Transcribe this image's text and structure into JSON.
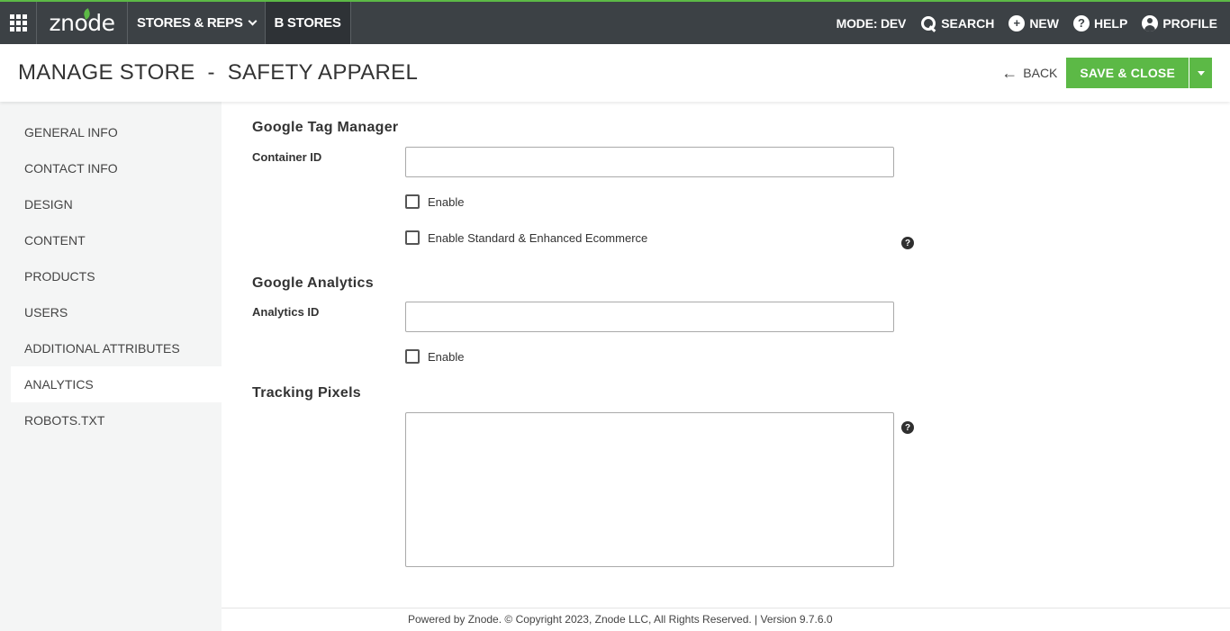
{
  "topbar": {
    "brand": "znode",
    "nav": [
      {
        "label": "STORES & REPS",
        "dropdown": true
      },
      {
        "label": "B STORES"
      }
    ],
    "mode": "MODE: DEV",
    "search": "SEARCH",
    "new": "NEW",
    "help": "HELP",
    "profile": "PROFILE",
    "accent_color": "#5cb946"
  },
  "header": {
    "title": "MANAGE STORE  -  SAFETY APPAREL",
    "back": "BACK",
    "save_close": "SAVE & CLOSE"
  },
  "sidebar": {
    "items": [
      {
        "label": "GENERAL INFO"
      },
      {
        "label": "CONTACT INFO"
      },
      {
        "label": "DESIGN"
      },
      {
        "label": "CONTENT"
      },
      {
        "label": "PRODUCTS"
      },
      {
        "label": "USERS"
      },
      {
        "label": "ADDITIONAL ATTRIBUTES"
      },
      {
        "label": "ANALYTICS",
        "active": true
      },
      {
        "label": "ROBOTS.TXT"
      }
    ]
  },
  "main": {
    "gtm": {
      "title": "Google Tag Manager",
      "container_label": "Container ID",
      "container_value": "",
      "enable_label": "Enable",
      "enable_ecommerce_label": "Enable Standard & Enhanced Ecommerce"
    },
    "ga": {
      "title": "Google Analytics",
      "analytics_label": "Analytics ID",
      "analytics_value": "",
      "enable_label": "Enable"
    },
    "tracking": {
      "title": "Tracking Pixels",
      "value": ""
    },
    "help_glyph": "?"
  },
  "footer": {
    "text": "Powered by Znode. © Copyright 2023, Znode LLC, All Rights Reserved. | Version 9.7.6.0"
  }
}
